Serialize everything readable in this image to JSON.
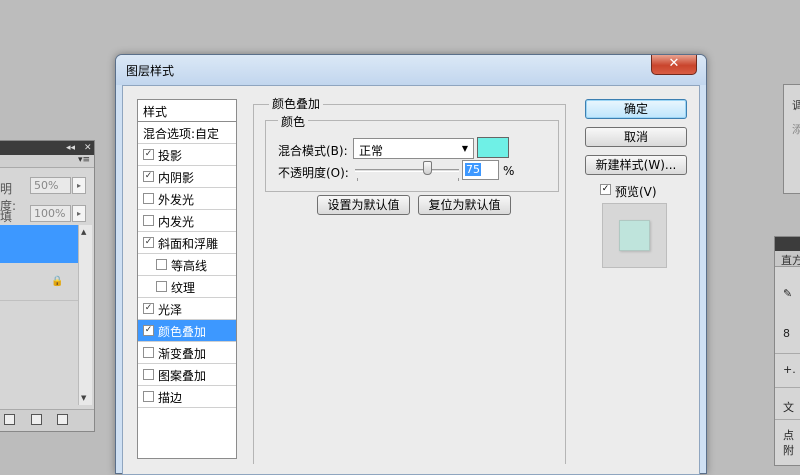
{
  "dialog": {
    "title": "图层样式",
    "close_glyph": "✕"
  },
  "style_list": {
    "header": "样式",
    "items": [
      {
        "label": "混合选项:自定",
        "checkbox": false,
        "checked": false,
        "indent": false,
        "selected": false
      },
      {
        "label": "投影",
        "checkbox": true,
        "checked": true,
        "indent": false,
        "selected": false
      },
      {
        "label": "内阴影",
        "checkbox": true,
        "checked": true,
        "indent": false,
        "selected": false
      },
      {
        "label": "外发光",
        "checkbox": true,
        "checked": false,
        "indent": false,
        "selected": false
      },
      {
        "label": "内发光",
        "checkbox": true,
        "checked": false,
        "indent": false,
        "selected": false
      },
      {
        "label": "斜面和浮雕",
        "checkbox": true,
        "checked": true,
        "indent": false,
        "selected": false
      },
      {
        "label": "等高线",
        "checkbox": true,
        "checked": false,
        "indent": true,
        "selected": false
      },
      {
        "label": "纹理",
        "checkbox": true,
        "checked": false,
        "indent": true,
        "selected": false
      },
      {
        "label": "光泽",
        "checkbox": true,
        "checked": true,
        "indent": false,
        "selected": false
      },
      {
        "label": "颜色叠加",
        "checkbox": true,
        "checked": true,
        "indent": false,
        "selected": true
      },
      {
        "label": "渐变叠加",
        "checkbox": true,
        "checked": false,
        "indent": false,
        "selected": false
      },
      {
        "label": "图案叠加",
        "checkbox": true,
        "checked": false,
        "indent": false,
        "selected": false
      },
      {
        "label": "描边",
        "checkbox": true,
        "checked": false,
        "indent": false,
        "selected": false
      }
    ]
  },
  "color_overlay": {
    "group_title": "颜色叠加",
    "subgroup_title": "颜色",
    "blend_mode_label": "混合模式(B):",
    "blend_mode_value": "正常",
    "overlay_color": "#6ff0e6",
    "opacity_label": "不透明度(O):",
    "opacity_value": "75",
    "opacity_unit": "%",
    "set_default_label": "设置为默认值",
    "reset_default_label": "复位为默认值"
  },
  "actions": {
    "ok_label": "确定",
    "cancel_label": "取消",
    "new_style_label": "新建样式(W)...",
    "preview_label": "预览(V)",
    "preview_checked": true,
    "preview_color": "#bfe4dc"
  },
  "left_panel": {
    "opacity_label": "明度:",
    "opacity_value": "50%",
    "fill_label": "填充:",
    "fill_value": "100%",
    "collapse_glyph": "◂◂",
    "close_glyph": "✕",
    "menu_glyph": "▾≡",
    "lock_glyph": "🔒",
    "scroll_up_glyph": "▲",
    "scroll_down_glyph": "▼",
    "arrow_glyph": "▸"
  },
  "right_panel": {
    "title_fragment": "调",
    "sub_fragment": "添",
    "tab_fragment": "直方",
    "row_8": "8",
    "row_plus": "+.",
    "row_text": "文",
    "row_dot": "点",
    "row_attach": "附"
  },
  "colors": {
    "selection": "#3d98ff",
    "close_button": "#c9452d"
  }
}
